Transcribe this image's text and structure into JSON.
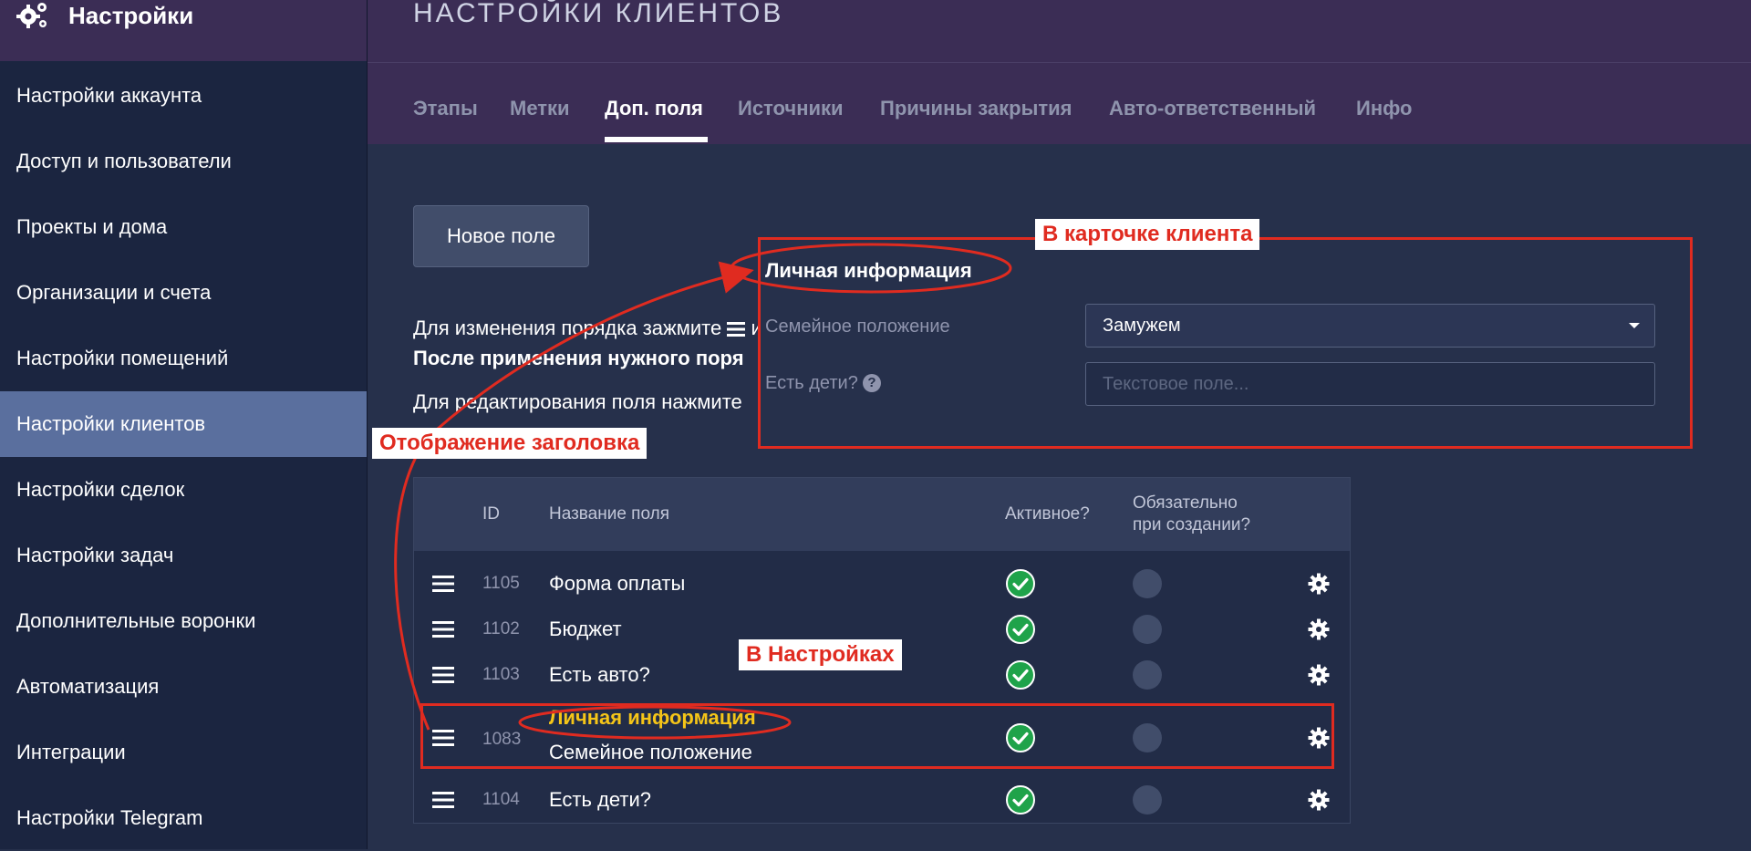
{
  "sidebar": {
    "title": "Настройки",
    "items": [
      {
        "label": "Настройки аккаунта"
      },
      {
        "label": "Доступ и пользователи"
      },
      {
        "label": "Проекты и дома"
      },
      {
        "label": "Организации и счета"
      },
      {
        "label": "Настройки помещений"
      },
      {
        "label": "Настройки клиентов",
        "active": true
      },
      {
        "label": "Настройки сделок"
      },
      {
        "label": "Настройки задач"
      },
      {
        "label": "Дополнительные воронки"
      },
      {
        "label": "Автоматизация"
      },
      {
        "label": "Интеграции"
      },
      {
        "label": "Настройки Telegram"
      }
    ]
  },
  "header": {
    "title": "НАСТРОЙКИ КЛИЕНТОВ",
    "tabs": [
      {
        "label": "Этапы"
      },
      {
        "label": "Метки"
      },
      {
        "label": "Доп. поля",
        "active": true
      },
      {
        "label": "Источники"
      },
      {
        "label": "Причины закрытия"
      },
      {
        "label": "Авто-ответственный"
      },
      {
        "label": "Инфо"
      }
    ]
  },
  "main": {
    "new_field_button": "Новое поле",
    "hint_reorder": "Для изменения порядка зажмите",
    "hint_reorder_tail": "и",
    "hint_apply": "После применения нужного поря",
    "hint_edit": "Для редактирования поля нажмите"
  },
  "table": {
    "headers": {
      "id": "ID",
      "name": "Название поля",
      "active": "Активное?",
      "required_line1": "Обязательно",
      "required_line2": "при создании?"
    },
    "rows": [
      {
        "id": "1105",
        "name": "Форма оплаты"
      },
      {
        "id": "1102",
        "name": "Бюджет"
      },
      {
        "id": "1103",
        "name": "Есть авто?"
      },
      {
        "id": "1083",
        "heading": "Личная информация",
        "name": "Семейное положение"
      },
      {
        "id": "1104",
        "name": "Есть дети?"
      }
    ]
  },
  "card_preview": {
    "title": "Личная информация",
    "field1_label": "Семейное положение",
    "field1_value": "Замужем",
    "field2_label": "Есть дети?",
    "field2_placeholder": "Текстовое поле..."
  },
  "annotations": {
    "card_callout": "В карточке клиента",
    "header_callout": "Отображение заголовка",
    "settings_callout": "В Настройках"
  },
  "colors": {
    "accent_red": "#e02b20",
    "highlight_yellow": "#f5c518",
    "check_green": "#1fa34a",
    "sidebar_active": "#5a6f9e",
    "header_purple": "#3b2d55"
  }
}
